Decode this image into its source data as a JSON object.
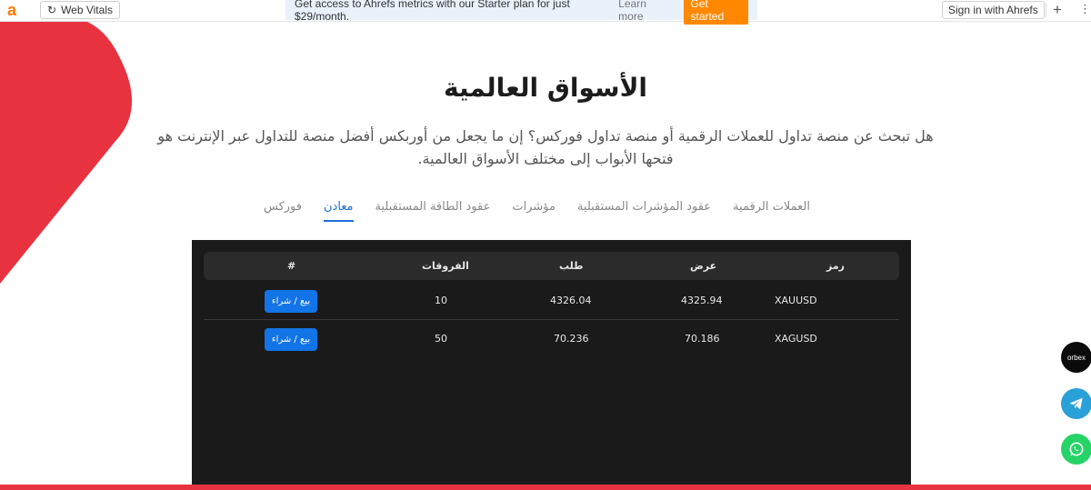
{
  "toolbar": {
    "logo_letter": "a",
    "web_vitals": "Web Vitals",
    "promo_text": "Get access to Ahrefs metrics with our Starter plan for just $29/month.",
    "learn_more": "Learn more",
    "get_started": "Get started",
    "sign_in": "Sign in with Ahrefs",
    "plus": "+",
    "more": "⋮"
  },
  "page": {
    "title": "الأسواق العالمية",
    "subtitle": "هل تبحث عن منصة تداول للعملات الرقمية أو منصة تداول فوركس؟ إن ما يجعل من أوربكس أفضل منصة للتداول عبر الإنترنت هو فتحها الأبواب إلى مختلف الأسواق العالمية."
  },
  "tabs": [
    {
      "label": "فوركس",
      "active": false
    },
    {
      "label": "معادن",
      "active": true
    },
    {
      "label": "عقود الطاقة المستقبلية",
      "active": false
    },
    {
      "label": "مؤشرات",
      "active": false
    },
    {
      "label": "عقود المؤشرات المستقبلية",
      "active": false
    },
    {
      "label": "العملات الرقمية",
      "active": false
    }
  ],
  "table": {
    "headers": {
      "symbol": "رمز",
      "bid": "عرض",
      "ask": "طلب",
      "spread": "الفروقات",
      "action": "#"
    },
    "rows": [
      {
        "symbol": "XAUUSD",
        "bid": "4325.94",
        "ask": "4326.04",
        "spread": "10",
        "action": "بيع / شراء"
      },
      {
        "symbol": "XAGUSD",
        "bid": "70.186",
        "ask": "70.236",
        "spread": "50",
        "action": "بيع / شراء"
      }
    ]
  },
  "floating": {
    "orbex_label": "orbex"
  },
  "colors": {
    "accent": "#1e6fd9",
    "brand_red": "#e8323f",
    "table_bg": "#1a1a1a",
    "button_blue": "#1274e6"
  }
}
